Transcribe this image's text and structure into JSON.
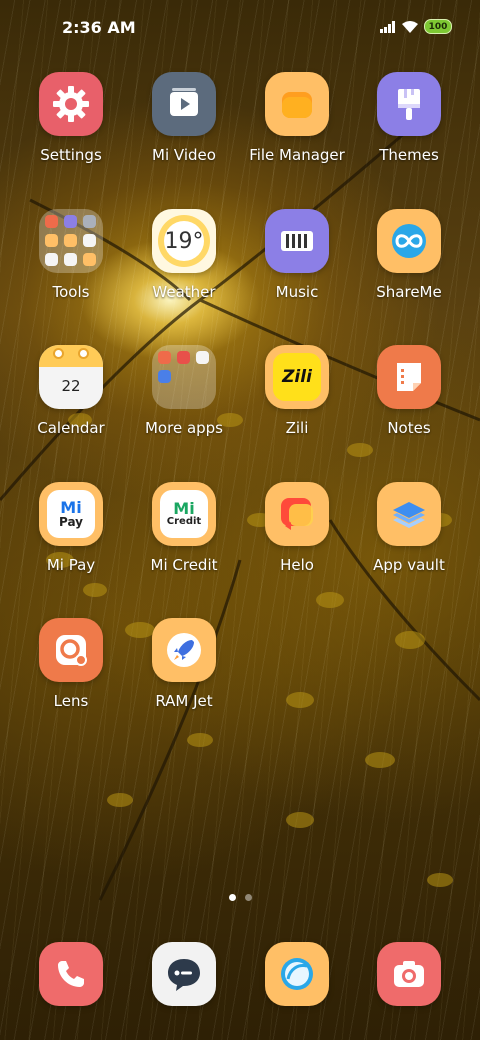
{
  "status_bar": {
    "time": "2:36 AM",
    "battery": "100"
  },
  "apps": [
    {
      "label": "Settings",
      "icon": "settings-icon",
      "color": "#e8606a"
    },
    {
      "label": "Mi Video",
      "icon": "play-video-icon",
      "color": "#5c6b7d"
    },
    {
      "label": "File Manager",
      "icon": "folder-icon",
      "color": "#ffbf66"
    },
    {
      "label": "Themes",
      "icon": "paintbrush-icon",
      "color": "#8c7fe6"
    },
    {
      "label": "Tools",
      "icon": "folder-grid-icon"
    },
    {
      "label": "Weather",
      "icon": "sun-icon",
      "temp": "19°"
    },
    {
      "label": "Music",
      "icon": "piano-keys-icon",
      "color": "#8c7fe6"
    },
    {
      "label": "ShareMe",
      "icon": "infinity-icon",
      "color": "#ffbf66"
    },
    {
      "label": "Calendar",
      "icon": "calendar-icon",
      "day": "22"
    },
    {
      "label": "More apps",
      "icon": "folder-grid-icon"
    },
    {
      "label": "Zili",
      "icon": "zili-logo-icon",
      "logo": "Zili"
    },
    {
      "label": "Notes",
      "icon": "note-icon",
      "color": "#ef7a4a"
    },
    {
      "label": "Mi Pay",
      "icon": "mi-pay-logo-icon",
      "logo_top": "Mi",
      "logo_bottom": "Pay"
    },
    {
      "label": "Mi Credit",
      "icon": "mi-credit-logo-icon",
      "logo_top": "Mi",
      "logo_bottom": "Credit"
    },
    {
      "label": "Helo",
      "icon": "helo-logo-icon",
      "color": "#ffbf66"
    },
    {
      "label": "App vault",
      "icon": "layers-icon",
      "color": "#ffbf66"
    },
    {
      "label": "Lens",
      "icon": "lens-icon",
      "color": "#ef7a4a"
    },
    {
      "label": "RAM Jet",
      "icon": "rocket-icon",
      "color": "#ffbf66"
    }
  ],
  "dock": [
    {
      "name": "phone",
      "icon": "phone-icon",
      "color": "#ef6b6b"
    },
    {
      "name": "messages",
      "icon": "message-icon",
      "color": "#f2f2f2"
    },
    {
      "name": "browser",
      "icon": "browser-icon",
      "color": "#ffbf66"
    },
    {
      "name": "camera",
      "icon": "camera-icon",
      "color": "#ef6b6b"
    }
  ],
  "pages": {
    "current": 1,
    "total": 2
  }
}
